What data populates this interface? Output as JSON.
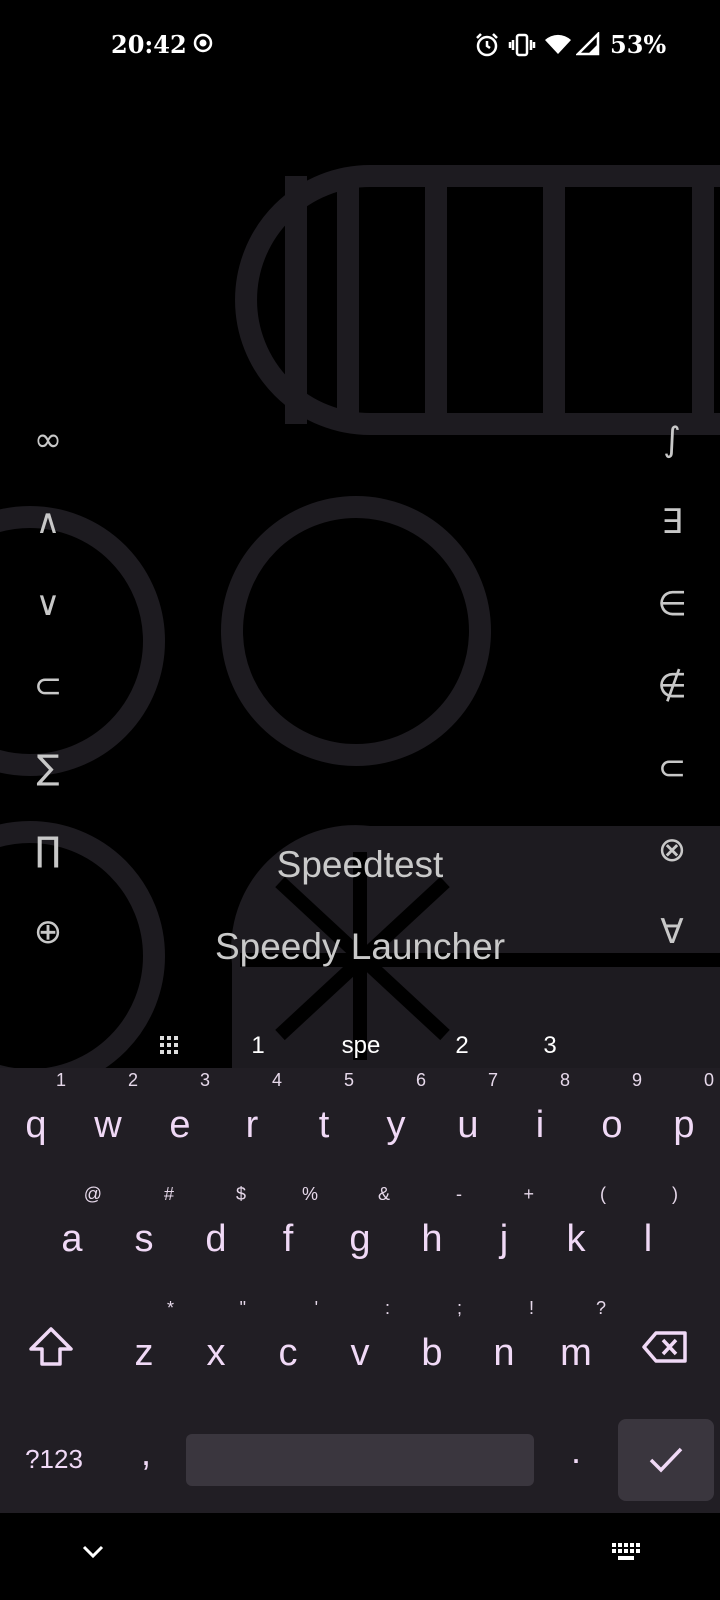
{
  "status_bar": {
    "time": "20:42",
    "battery": "53%"
  },
  "side_symbols": {
    "left": [
      "∞",
      "∧",
      "∨",
      "⊂",
      "∑",
      "∏",
      "⊕"
    ],
    "right": [
      "∫",
      "∃",
      "∈",
      "∉",
      "⊂",
      "⊗",
      "∀"
    ]
  },
  "results": [
    {
      "label": "Speedtest"
    },
    {
      "label": "Speedy Launcher"
    }
  ],
  "suggestions": {
    "first": "1",
    "middle": "spe",
    "second": "2",
    "third": "3"
  },
  "keyboard": {
    "row1": [
      {
        "key": "q",
        "hint": "1"
      },
      {
        "key": "w",
        "hint": "2"
      },
      {
        "key": "e",
        "hint": "3"
      },
      {
        "key": "r",
        "hint": "4"
      },
      {
        "key": "t",
        "hint": "5"
      },
      {
        "key": "y",
        "hint": "6"
      },
      {
        "key": "u",
        "hint": "7"
      },
      {
        "key": "i",
        "hint": "8"
      },
      {
        "key": "o",
        "hint": "9"
      },
      {
        "key": "p",
        "hint": "0"
      }
    ],
    "row2": [
      {
        "key": "a",
        "hint": "@"
      },
      {
        "key": "s",
        "hint": "#"
      },
      {
        "key": "d",
        "hint": "$"
      },
      {
        "key": "f",
        "hint": "%"
      },
      {
        "key": "g",
        "hint": "&"
      },
      {
        "key": "h",
        "hint": "-"
      },
      {
        "key": "j",
        "hint": "+"
      },
      {
        "key": "k",
        "hint": "("
      },
      {
        "key": "l",
        "hint": ")"
      }
    ],
    "row3": [
      {
        "key": "z",
        "hint": "*"
      },
      {
        "key": "x",
        "hint": "\""
      },
      {
        "key": "c",
        "hint": "'"
      },
      {
        "key": "v",
        "hint": ":"
      },
      {
        "key": "b",
        "hint": ";"
      },
      {
        "key": "n",
        "hint": "!"
      },
      {
        "key": "m",
        "hint": "?"
      }
    ],
    "symbols_label": "?123",
    "comma": ",",
    "period": "."
  },
  "icons": {
    "status_record": "record-icon",
    "status_alarm": "alarm-icon",
    "status_vibrate": "vibrate-icon",
    "status_wifi": "wifi-icon",
    "status_signal": "signal-icon",
    "suggestion_grid": "grid-icon",
    "shift": "shift-icon",
    "backspace": "backspace-icon",
    "enter": "checkmark-icon",
    "nav_hide": "chevron-down-icon",
    "nav_keyboard": "keyboard-icon"
  },
  "colors": {
    "background": "#000000",
    "keyboard_bg": "#211e24",
    "key_text": "#f0d9f6",
    "key_special_bg": "#3a363e"
  }
}
